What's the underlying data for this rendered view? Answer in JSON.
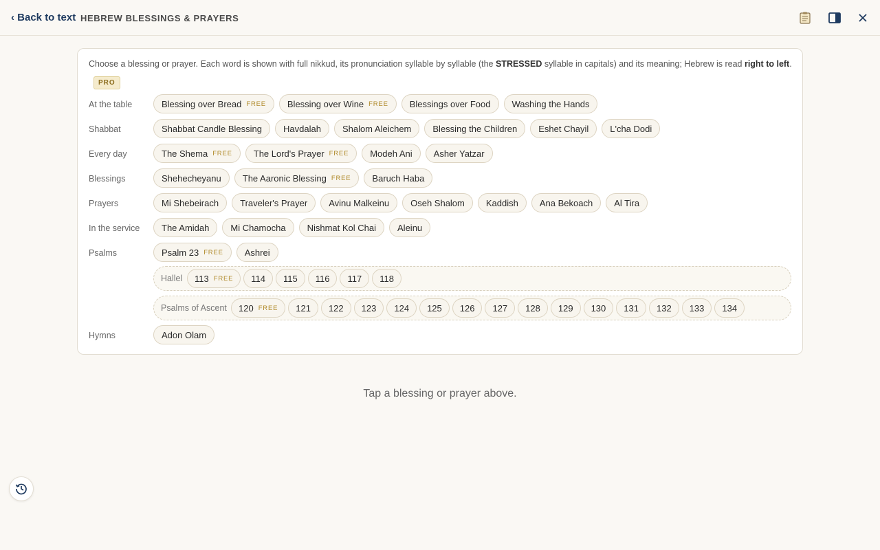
{
  "header": {
    "back_label": "‹ Back to text",
    "title": "HEBREW BLESSINGS & PRAYERS",
    "icons": [
      "notes-icon",
      "side-panel-icon",
      "close-icon"
    ]
  },
  "intro": {
    "part1": "Choose a blessing or prayer. Each word is shown with full nikkud, its pronunciation syllable by syllable (the ",
    "stressed": "STRESSED",
    "part2": " syllable in capitals) and its meaning; Hebrew is read ",
    "rtl": "right to left",
    "part3": ".",
    "pro_badge": "PRO"
  },
  "free_tag": "FREE",
  "rows": [
    {
      "label": "At the table",
      "chips": [
        {
          "label": "Blessing over Bread",
          "free": true
        },
        {
          "label": "Blessing over Wine",
          "free": true
        },
        {
          "label": "Blessings over Food",
          "free": false
        },
        {
          "label": "Washing the Hands",
          "free": false
        }
      ]
    },
    {
      "label": "Shabbat",
      "chips": [
        {
          "label": "Shabbat Candle Blessing",
          "free": false
        },
        {
          "label": "Havdalah",
          "free": false
        },
        {
          "label": "Shalom Aleichem",
          "free": false
        },
        {
          "label": "Blessing the Children",
          "free": false
        },
        {
          "label": "Eshet Chayil",
          "free": false
        },
        {
          "label": "L'cha Dodi",
          "free": false
        }
      ]
    },
    {
      "label": "Every day",
      "chips": [
        {
          "label": "The Shema",
          "free": true
        },
        {
          "label": "The Lord's Prayer",
          "free": true
        },
        {
          "label": "Modeh Ani",
          "free": false
        },
        {
          "label": "Asher Yatzar",
          "free": false
        }
      ]
    },
    {
      "label": "Blessings",
      "chips": [
        {
          "label": "Shehecheyanu",
          "free": false
        },
        {
          "label": "The Aaronic Blessing",
          "free": true
        },
        {
          "label": "Baruch Haba",
          "free": false
        }
      ]
    },
    {
      "label": "Prayers",
      "chips": [
        {
          "label": "Mi Shebeirach",
          "free": false
        },
        {
          "label": "Traveler's Prayer",
          "free": false
        },
        {
          "label": "Avinu Malkeinu",
          "free": false
        },
        {
          "label": "Oseh Shalom",
          "free": false
        },
        {
          "label": "Kaddish",
          "free": false
        },
        {
          "label": "Ana Bekoach",
          "free": false
        },
        {
          "label": "Al Tira",
          "free": false
        }
      ]
    },
    {
      "label": "In the service",
      "chips": [
        {
          "label": "The Amidah",
          "free": false
        },
        {
          "label": "Mi Chamocha",
          "free": false
        },
        {
          "label": "Nishmat Kol Chai",
          "free": false
        },
        {
          "label": "Aleinu",
          "free": false
        }
      ]
    },
    {
      "label": "Psalms",
      "chips": [
        {
          "label": "Psalm 23",
          "free": true
        },
        {
          "label": "Ashrei",
          "free": false
        }
      ]
    }
  ],
  "groups": [
    {
      "label": "Hallel",
      "chips": [
        {
          "label": "113",
          "free": true
        },
        {
          "label": "114",
          "free": false
        },
        {
          "label": "115",
          "free": false
        },
        {
          "label": "116",
          "free": false
        },
        {
          "label": "117",
          "free": false
        },
        {
          "label": "118",
          "free": false
        }
      ]
    },
    {
      "label": "Psalms of Ascent",
      "chips": [
        {
          "label": "120",
          "free": true
        },
        {
          "label": "121",
          "free": false
        },
        {
          "label": "122",
          "free": false
        },
        {
          "label": "123",
          "free": false
        },
        {
          "label": "124",
          "free": false
        },
        {
          "label": "125",
          "free": false
        },
        {
          "label": "126",
          "free": false
        },
        {
          "label": "127",
          "free": false
        },
        {
          "label": "128",
          "free": false
        },
        {
          "label": "129",
          "free": false
        },
        {
          "label": "130",
          "free": false
        },
        {
          "label": "131",
          "free": false
        },
        {
          "label": "132",
          "free": false
        },
        {
          "label": "133",
          "free": false
        },
        {
          "label": "134",
          "free": false
        }
      ]
    }
  ],
  "hymns": {
    "label": "Hymns",
    "chips": [
      {
        "label": "Adon Olam",
        "free": false
      }
    ]
  },
  "hint": "Tap a blessing or prayer above.",
  "colors": {
    "accent": "#1e3a5f",
    "free_tag": "#b08a2a",
    "background": "#faf8f4"
  }
}
